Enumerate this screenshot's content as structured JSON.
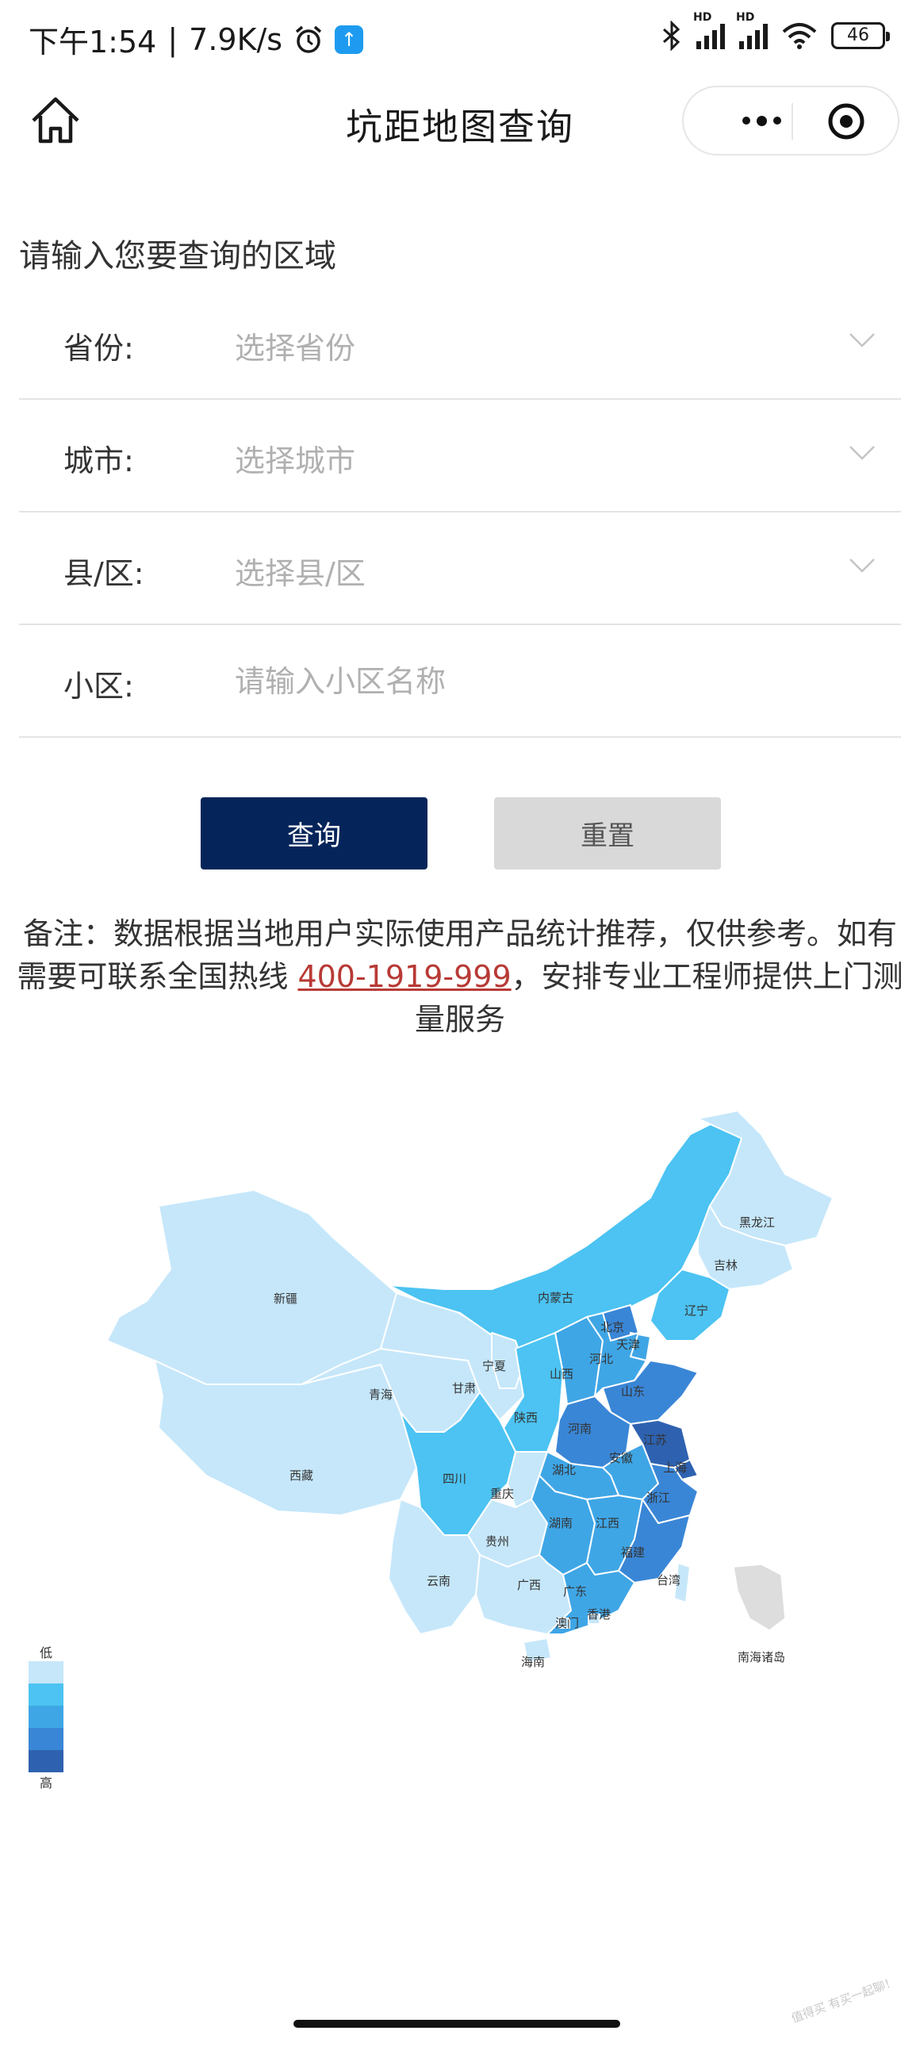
{
  "status_bar": {
    "time": "下午1:54",
    "speed": "7.9K/s",
    "app_badge": "↑",
    "hd1": "HD",
    "hd2": "HD",
    "battery": "46"
  },
  "nav": {
    "title": "坑距地图查询"
  },
  "form": {
    "heading": "请输入您要查询的区域",
    "province": {
      "label": "省份:",
      "placeholder": "选择省份"
    },
    "city": {
      "label": "城市:",
      "placeholder": "选择城市"
    },
    "county": {
      "label": "县/区:",
      "placeholder": "选择县/区"
    },
    "community": {
      "label": "小区:",
      "placeholder": "请输入小区名称"
    },
    "query_label": "查询",
    "reset_label": "重置"
  },
  "note": {
    "prefix": "备注：数据根据当地用户实际使用产品统计推荐，仅供参考。如有需要可联系全国热线 ",
    "phone": "400-1919-999",
    "suffix": "，安排专业工程师提供上门测量服务"
  },
  "map": {
    "regions": [
      {
        "name": "新疆",
        "level": 1
      },
      {
        "name": "西藏",
        "level": 1
      },
      {
        "name": "青海",
        "level": 1
      },
      {
        "name": "甘肃",
        "level": 1
      },
      {
        "name": "内蒙古",
        "level": 2
      },
      {
        "name": "黑龙江",
        "level": 1
      },
      {
        "name": "吉林",
        "level": 1
      },
      {
        "name": "辽宁",
        "level": 2
      },
      {
        "name": "宁夏",
        "level": 1
      },
      {
        "name": "陕西",
        "level": 2
      },
      {
        "name": "山西",
        "level": 3
      },
      {
        "name": "北京",
        "level": 4
      },
      {
        "name": "天津",
        "level": 3
      },
      {
        "name": "河北",
        "level": 3
      },
      {
        "name": "山东",
        "level": 4
      },
      {
        "name": "河南",
        "level": 4
      },
      {
        "name": "江苏",
        "level": 5
      },
      {
        "name": "上海",
        "level": 5
      },
      {
        "name": "安徽",
        "level": 3
      },
      {
        "name": "湖北",
        "level": 3
      },
      {
        "name": "四川",
        "level": 2
      },
      {
        "name": "重庆",
        "level": 1
      },
      {
        "name": "贵州",
        "level": 1
      },
      {
        "name": "湖南",
        "level": 3
      },
      {
        "name": "江西",
        "level": 3
      },
      {
        "name": "浙江",
        "level": 4
      },
      {
        "name": "福建",
        "level": 4
      },
      {
        "name": "云南",
        "level": 1
      },
      {
        "name": "广西",
        "level": 1
      },
      {
        "name": "广东",
        "level": 3
      },
      {
        "name": "澳门",
        "level": 1
      },
      {
        "name": "香港",
        "level": 1
      },
      {
        "name": "台湾",
        "level": 1
      },
      {
        "name": "海南",
        "level": 1
      },
      {
        "name": "南海诸岛",
        "level": 0
      }
    ],
    "legend": {
      "low": "低",
      "high": "高"
    },
    "colors": [
      "#c6e7fa",
      "#4cc3f2",
      "#3fa6e6",
      "#3a86d6",
      "#2e62b0"
    ]
  },
  "watermark": "值得买 有买一起聊！"
}
